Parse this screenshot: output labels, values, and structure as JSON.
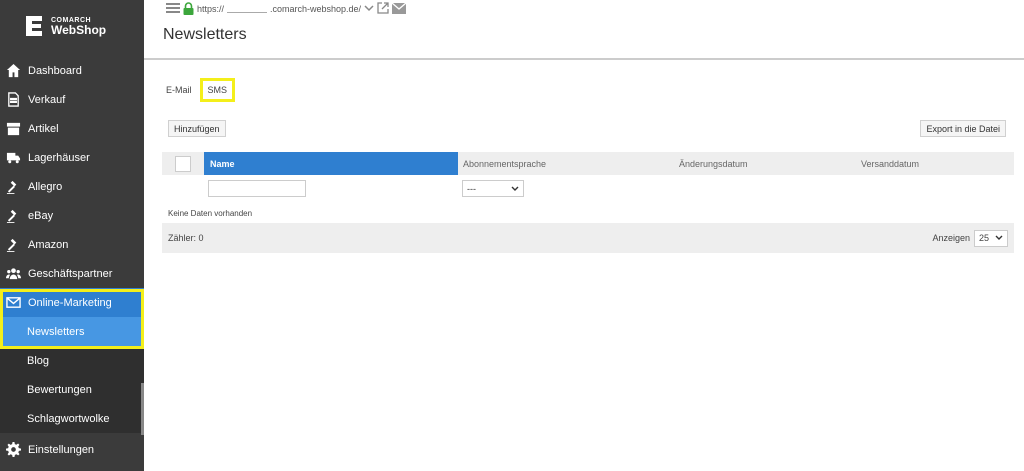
{
  "brand": {
    "line1": "COMARCH",
    "line2": "WebShop"
  },
  "url": {
    "prefix": "https://",
    "domain": ".comarch-webshop.de/"
  },
  "page": {
    "title": "Newsletters"
  },
  "sidebar": {
    "items": [
      {
        "label": "Dashboard",
        "icon": "home-icon"
      },
      {
        "label": "Verkauf",
        "icon": "document-icon"
      },
      {
        "label": "Artikel",
        "icon": "archive-icon"
      },
      {
        "label": "Lagerhäuser",
        "icon": "truck-icon"
      },
      {
        "label": "Allegro",
        "icon": "gavel-icon"
      },
      {
        "label": "eBay",
        "icon": "gavel-icon"
      },
      {
        "label": "Amazon",
        "icon": "gavel-icon"
      },
      {
        "label": "Geschäftspartner",
        "icon": "users-icon"
      },
      {
        "label": "Online-Marketing",
        "icon": "envelope-icon"
      }
    ],
    "subitems": [
      {
        "label": "Newsletters"
      },
      {
        "label": "Blog"
      },
      {
        "label": "Bewertungen"
      },
      {
        "label": "Schlagwortwolke"
      }
    ],
    "settings": {
      "label": "Einstellungen",
      "icon": "gear-icon"
    }
  },
  "tabs": {
    "email": "E-Mail",
    "sms": "SMS"
  },
  "toolbar": {
    "add_label": "Hinzufügen",
    "export_label": "Export in die Datei"
  },
  "table": {
    "columns": {
      "name": "Name",
      "language": "Abonnementsprache",
      "changed": "Änderungsdatum",
      "sent": "Versanddatum"
    },
    "filter_select_value": "---",
    "empty_text": "Keine Daten vorhanden"
  },
  "footer": {
    "counter": "Zähler: 0",
    "show_label": "Anzeigen",
    "page_size": "25"
  },
  "colors": {
    "sidebar": "#3b3b3b",
    "accent": "#2f7fd0",
    "highlight": "#f4ef1a"
  }
}
